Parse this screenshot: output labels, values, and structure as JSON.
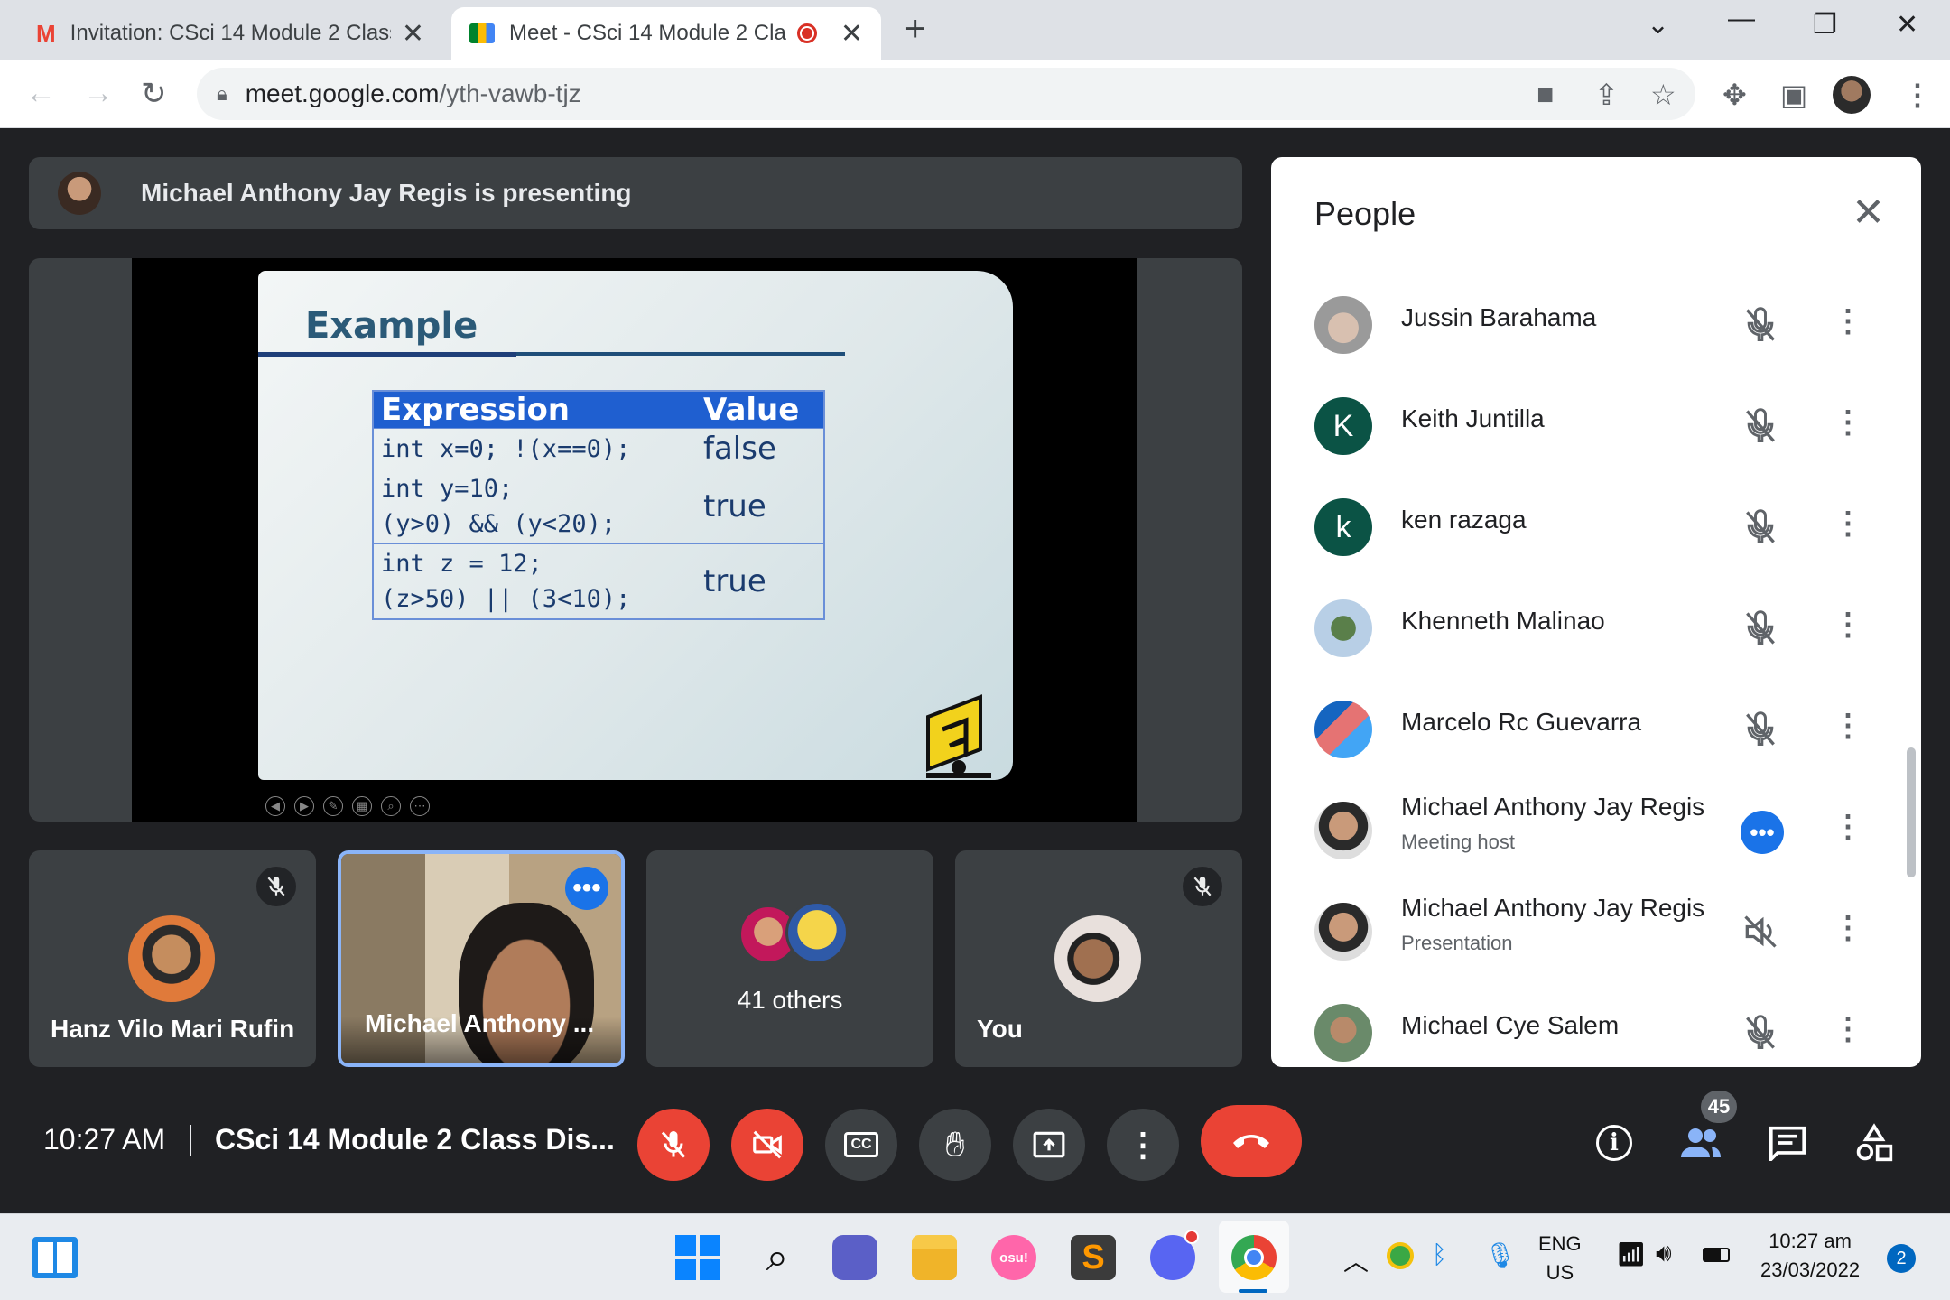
{
  "browser": {
    "tabs": [
      {
        "title": "Invitation: CSci 14 Module 2 Class",
        "active": false,
        "icon": "gmail-icon"
      },
      {
        "title": "Meet - CSci 14 Module 2 Cla",
        "active": true,
        "icon": "meet-icon",
        "recording": true
      }
    ],
    "url_host": "meet.google.com",
    "url_path": "/yth-vawb-tjz"
  },
  "presenting_banner": "Michael Anthony Jay Regis is presenting",
  "slide": {
    "title": "Example",
    "table": {
      "headers": [
        "Expression",
        "Value"
      ],
      "rows": [
        {
          "expr": "int x=0; !(x==0);",
          "value": "false"
        },
        {
          "expr": "int y=10;\n(y>0) && (y<20);",
          "value": "true"
        },
        {
          "expr": "int z = 12;\n(z>50) || (3<10);",
          "value": "true"
        }
      ]
    }
  },
  "tiles": [
    {
      "name": "Hanz Vilo Mari Rufin",
      "muted": true
    },
    {
      "name": "Michael Anthony ...",
      "active_speaker": true
    },
    {
      "name": "41 others"
    },
    {
      "name": "You",
      "muted": true
    }
  ],
  "people_panel": {
    "title": "People",
    "participants": [
      {
        "name": "Jussin Barahama",
        "sub": "",
        "initial": "",
        "status": "muted"
      },
      {
        "name": "Keith Juntilla",
        "sub": "",
        "initial": "K",
        "color": "#0b5345",
        "status": "muted"
      },
      {
        "name": "ken razaga",
        "sub": "",
        "initial": "k",
        "color": "#0b5345",
        "status": "muted"
      },
      {
        "name": "Khenneth Malinao",
        "sub": "",
        "initial": "",
        "status": "muted"
      },
      {
        "name": "Marcelo Rc Guevarra",
        "sub": "",
        "initial": "",
        "status": "muted"
      },
      {
        "name": "Michael Anthony Jay Regis",
        "sub": "Meeting host",
        "initial": "",
        "status": "speaking"
      },
      {
        "name": "Michael Anthony Jay Regis",
        "sub": "Presentation",
        "initial": "",
        "status": "volume-off"
      },
      {
        "name": "Michael Cye Salem",
        "sub": "",
        "initial": "",
        "status": "muted"
      }
    ]
  },
  "bottom_bar": {
    "time": "10:27 AM",
    "meeting_name": "CSci 14 Module 2 Class Dis...",
    "people_count": "45"
  },
  "taskbar": {
    "lang_line1": "ENG",
    "lang_line2": "US",
    "time": "10:27 am",
    "date": "23/03/2022",
    "notifications": "2"
  }
}
